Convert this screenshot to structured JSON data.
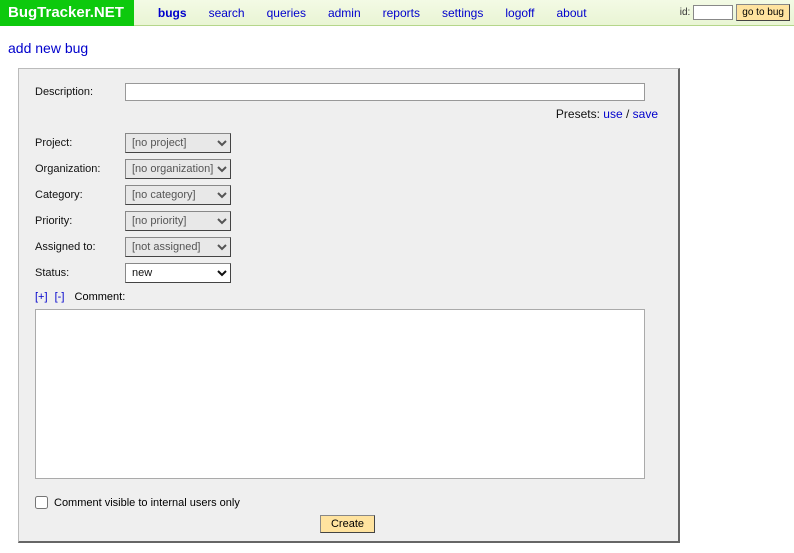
{
  "header": {
    "logo": "BugTracker.NET",
    "nav": {
      "bugs": "bugs",
      "search": "search",
      "queries": "queries",
      "admin": "admin",
      "reports": "reports",
      "settings": "settings",
      "logoff": "logoff",
      "about": "about"
    },
    "id_label": "id:",
    "id_value": "",
    "go_label": "go to bug"
  },
  "page_title": "add new bug",
  "form": {
    "description_label": "Description:",
    "description_value": "",
    "presets_label": "Presets:",
    "presets_use": "use",
    "presets_sep": " / ",
    "presets_save": "save",
    "project_label": "Project:",
    "project_value": "[no project]",
    "organization_label": "Organization:",
    "organization_value": "[no organization]",
    "category_label": "Category:",
    "category_value": "[no category]",
    "priority_label": "Priority:",
    "priority_value": "[no priority]",
    "assigned_label": "Assigned to:",
    "assigned_value": "[not assigned]",
    "status_label": "Status:",
    "status_value": "new",
    "expand": "[+]",
    "collapse": "[-]",
    "comment_label": "Comment:",
    "comment_value": "",
    "visibility_label": "Comment visible to internal users only",
    "create_label": "Create"
  }
}
